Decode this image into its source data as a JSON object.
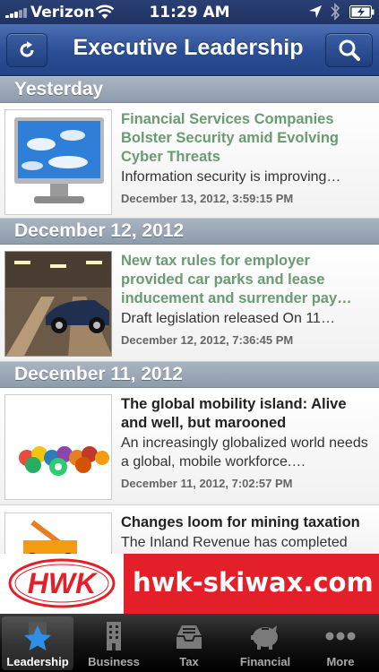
{
  "status_bar": {
    "carrier": "Verizon",
    "time": "11:29 AM"
  },
  "nav": {
    "title": "Executive Leadership",
    "left_icon": "refresh-icon",
    "right_icon": "search-icon"
  },
  "sections": [
    {
      "header": "Yesterday",
      "items": [
        {
          "title": "Financial Services Companies Bolster Security amid Evolving Cyber Threats",
          "summary": "Information security is improving…",
          "date": "December 13, 2012, 3:59:15 PM",
          "thumbnail": "computer-monitor-sky"
        }
      ]
    },
    {
      "header": "December 12, 2012",
      "items": [
        {
          "title": "New tax rules for employer provided car parks and lease inducement and surrender pay…",
          "summary": "Draft legislation released On 11…",
          "date": "December 12, 2012, 7:36:45 PM",
          "thumbnail": "car-in-parking-garage"
        }
      ]
    },
    {
      "header": "December 11, 2012",
      "items": [
        {
          "title": "The global mobility island: Alive and well, but marooned",
          "summary": "An increasingly globalized world needs a global, mobile workforce.…",
          "date": "December 11, 2012, 7:02:57 PM",
          "thumbnail": "billiard-balls"
        },
        {
          "title": "Changes loom for mining taxation",
          "summary": "The Inland Revenue has completed",
          "date": "",
          "thumbnail": "mining-truck"
        }
      ]
    }
  ],
  "ad": {
    "logo_text": "HWK",
    "text": "hwk-skiwax.com"
  },
  "tabs": [
    {
      "label": "Leadership",
      "icon": "star-icon",
      "active": true
    },
    {
      "label": "Business",
      "icon": "building-icon",
      "active": false
    },
    {
      "label": "Tax",
      "icon": "inbox-tray-icon",
      "active": false
    },
    {
      "label": "Financial",
      "icon": "piggy-bank-icon",
      "active": false
    },
    {
      "label": "More",
      "icon": "more-dots-icon",
      "active": false
    }
  ],
  "colors": {
    "unread_title": "#6a9b73",
    "read_title": "#222222",
    "nav_blue": "#2b4d94",
    "ad_red": "#e3202a"
  }
}
